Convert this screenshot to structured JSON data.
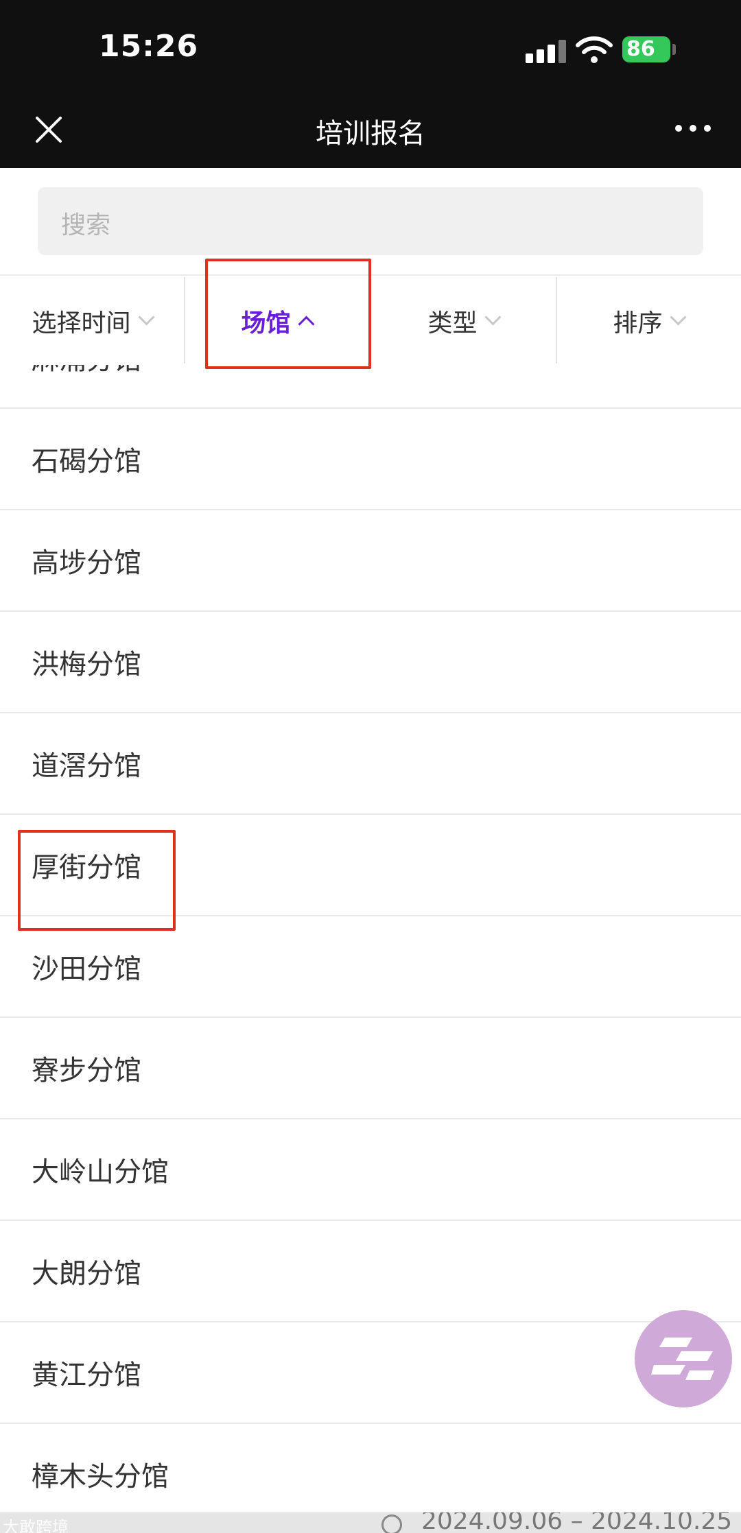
{
  "status_bar": {
    "time": "15:26",
    "battery": "86"
  },
  "nav": {
    "title": "培训报名"
  },
  "search": {
    "placeholder": "搜索"
  },
  "filters": [
    {
      "label": "选择时间",
      "active": false
    },
    {
      "label": "场馆",
      "active": true
    },
    {
      "label": "类型",
      "active": false
    },
    {
      "label": "排序",
      "active": false
    }
  ],
  "venues": [
    "麻涌分馆",
    "石碣分馆",
    "高埗分馆",
    "洪梅分馆",
    "道滘分馆",
    "厚街分馆",
    "沙田分馆",
    "寮步分馆",
    "大岭山分馆",
    "大朗分馆",
    "黄江分馆",
    "樟木头分馆"
  ],
  "underlying_card": {
    "date_range": "2024.09.06 – 2024.10.25"
  },
  "watermark": "大敢跨境",
  "colors": {
    "accent": "#6a1fd6",
    "annotation": "#e0301e",
    "fab": "#cfa9d8"
  }
}
